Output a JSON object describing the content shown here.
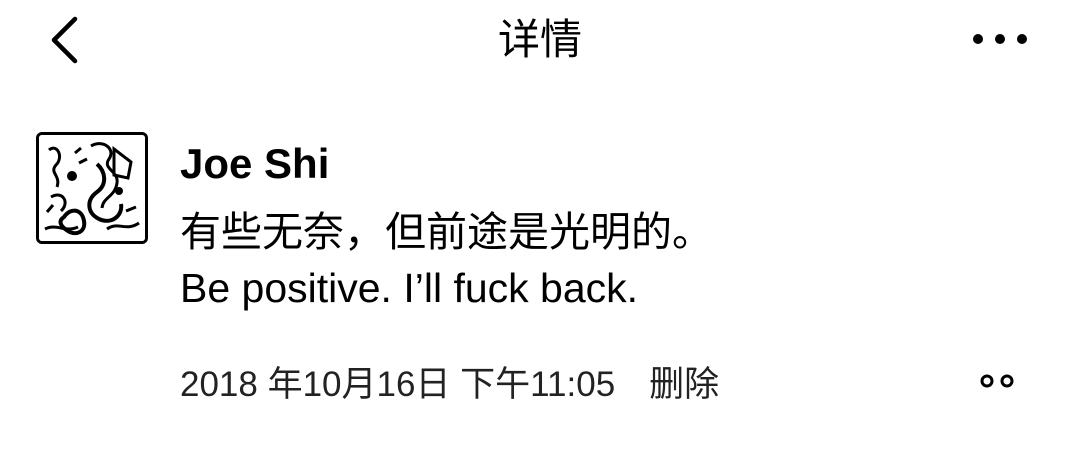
{
  "nav": {
    "title": "详情",
    "back_icon": "chevron-left-icon",
    "more_icon": "more-horizontal-icon"
  },
  "post": {
    "author": "Joe Shi",
    "avatar_icon": "avatar-image",
    "text_lines": [
      "有些无奈，但前途是光明的。",
      "Be positive. I’ll fuck back."
    ],
    "timestamp": "2018 年10月16日  下午11:05",
    "delete_label": "删除",
    "action_icon": "comment-like-menu-icon"
  },
  "colors": {
    "background": "#ffffff",
    "text": "#000000"
  }
}
